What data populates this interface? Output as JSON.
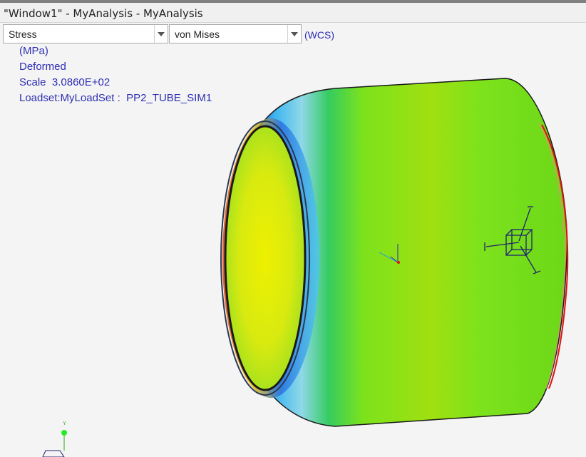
{
  "window": {
    "title": "\"Window1\" - MyAnalysis - MyAnalysis"
  },
  "toolbar": {
    "result_type": "Stress",
    "component": "von Mises",
    "coordinate_system": "(WCS)"
  },
  "legend": {
    "units": "(MPa)",
    "display": "Deformed",
    "scale_label": "Scale",
    "scale_value": "3.0860E+02",
    "loadset_label": "Loadset:MyLoadSet :",
    "loadset_value": "PP2_TUBE_SIM1"
  },
  "triad": {
    "y_label": "Y"
  },
  "colors": {
    "legend_text": "#2f2fb4",
    "stress_low": "#1e50dc",
    "stress_mid_low": "#3cb4f0",
    "stress_mid": "#7ce21c",
    "stress_high": "#f0f000",
    "stress_max": "#e01010"
  }
}
